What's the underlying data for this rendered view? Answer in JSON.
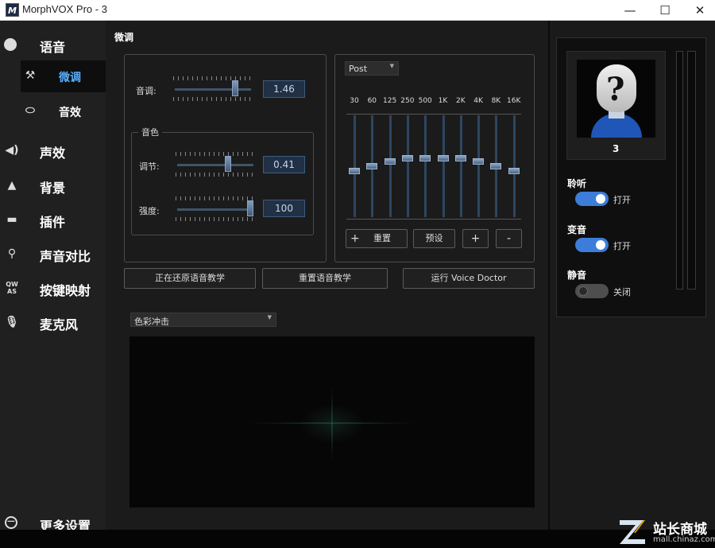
{
  "window": {
    "title": "MorphVOX Pro - 3",
    "logo": "M",
    "minimize": "—",
    "maximize": "☐",
    "close": "✕"
  },
  "sidebar": {
    "voice": "语音",
    "tweak": "微调",
    "effects": "音效",
    "sound_effects": "声效",
    "background": "背景",
    "plugins": "插件",
    "compare": "声音对比",
    "keys": "按键映射",
    "mic": "麦克风",
    "more": "更多设置",
    "icons": [
      "voice-icon",
      "wrench-icon",
      "lips-icon",
      "speaker-icon",
      "mountain-icon",
      "plug-icon",
      "search-icon",
      "keyboard-icon",
      "microphone-icon",
      "more-icon"
    ]
  },
  "tweak": {
    "title": "微调",
    "pitch_label": "音调:",
    "pitch_value": "1.46",
    "pitch_fraction": 0.82,
    "timbre_group": "音色",
    "adjust_label": "调节:",
    "adjust_value": "0.41",
    "adjust_fraction": 0.68,
    "strength_label": "强度:",
    "strength_value": "100",
    "strength_fraction": 1.0
  },
  "eq": {
    "mode": "Post",
    "bands": [
      "30",
      "60",
      "125",
      "250",
      "500",
      "1K",
      "2K",
      "4K",
      "8K",
      "16K"
    ],
    "levels": [
      0.45,
      0.5,
      0.55,
      0.58,
      0.58,
      0.58,
      0.58,
      0.55,
      0.5,
      0.45
    ],
    "reset": "重置",
    "preset": "预设",
    "plus": "+",
    "minus": "-"
  },
  "actions": {
    "restore_tutorial": "正在还原语音教学",
    "reset_tutorial": "重置语音教学",
    "voice_doctor": "运行 Voice Doctor"
  },
  "visualizer": {
    "mode": "色彩冲击"
  },
  "right": {
    "avatar_label": "3",
    "listen": "聆听",
    "listen_state": "打开",
    "morph": "变音",
    "morph_state": "打开",
    "mute": "静音",
    "mute_state": "关闭",
    "accent": "#3c7dd9"
  },
  "watermark": {
    "brand": "站长商城",
    "url": "mall.chinaz.com"
  }
}
